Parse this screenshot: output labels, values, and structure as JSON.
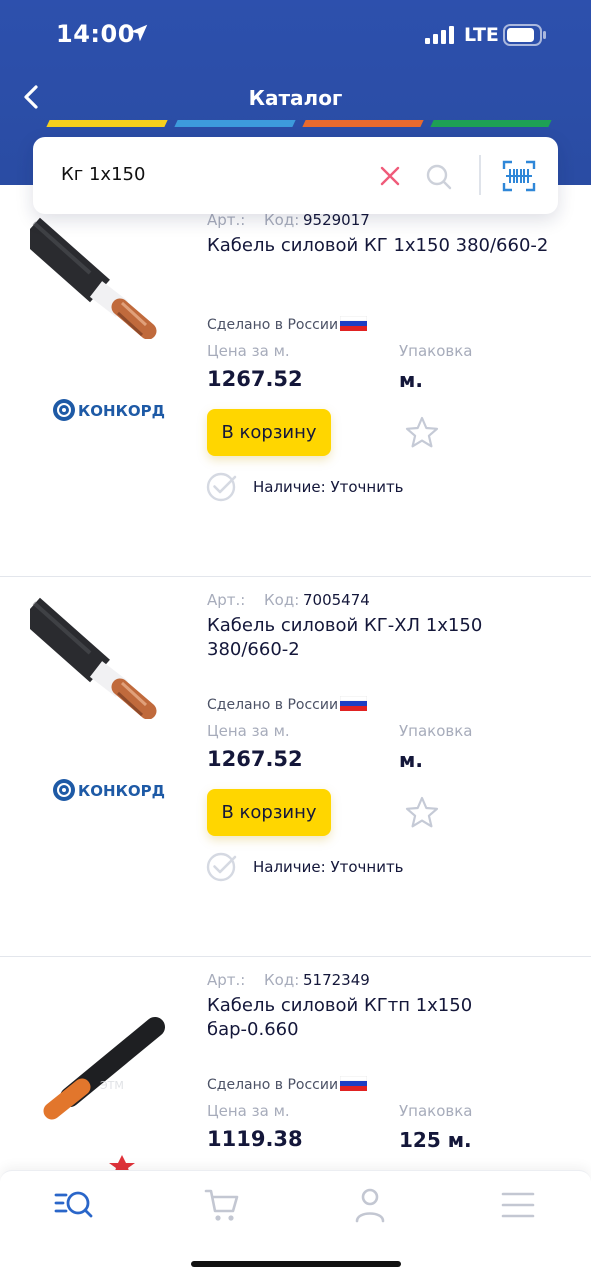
{
  "status_bar": {
    "time": "14:00",
    "network": "LTE"
  },
  "header": {
    "title": "Каталог",
    "stripe_colors": [
      "#f5cf1d",
      "#3d9bdc",
      "#e86a2e",
      "#1ea055"
    ]
  },
  "search": {
    "query": "Кг 1х150",
    "clear_icon": "close-icon",
    "search_icon": "search-icon",
    "scan_icon": "barcode-scan-icon"
  },
  "labels": {
    "art": "Арт.:",
    "code": "Код:",
    "made_in": "Сделано в России",
    "price_per": "Цена за  м.",
    "package": "Упаковка",
    "to_cart": "В корзину",
    "availability": "Наличие: Уточнить"
  },
  "products": [
    {
      "code": "9529017",
      "name": "Кабель силовой КГ 1х150 380/660-2",
      "price": "1267.52",
      "pack": "м.",
      "brand": "КОНКОРД"
    },
    {
      "code": "7005474",
      "name": "Кабель силовой КГ-ХЛ 1х150 380/660-2",
      "price": "1267.52",
      "pack": "м.",
      "brand": "КОНКОРД"
    },
    {
      "code": "5172349",
      "name": "Кабель силовой КГтп 1х150 бар-0.660",
      "price": "1119.38",
      "pack": "125 м.",
      "brand": ""
    }
  ],
  "tabbar": {
    "items": [
      "catalog-search-icon",
      "cart-icon",
      "profile-icon",
      "menu-icon"
    ],
    "active_color": "#2a66c9",
    "inactive_color": "#c3c7d2"
  },
  "colors": {
    "header_bg": "#2c4fa8",
    "cart_button": "#ffd600",
    "clear_icon": "#ef5b7a"
  }
}
